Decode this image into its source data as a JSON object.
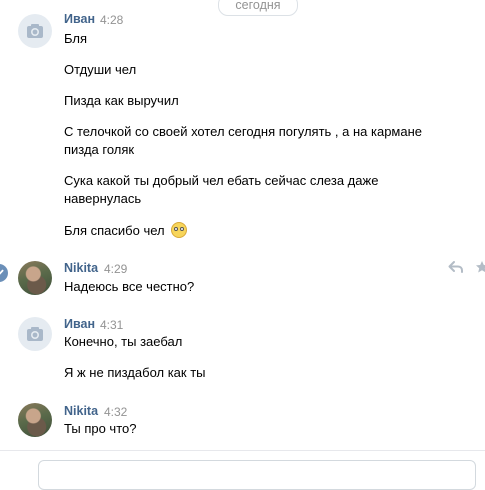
{
  "date_separator": "сегодня",
  "messages": [
    {
      "author": "Иван",
      "time": "4:28",
      "avatar": "camera-placeholder-icon",
      "lines": [
        [
          "Бля"
        ],
        [
          "Отдуши чел"
        ],
        [
          "Пизда как выручил"
        ],
        [
          "С телочкой со своей хотел сегодня погулять , а на кармане",
          "пизда голяк"
        ],
        [
          "Сука какой ты добрый чел ебать сейчас слеза даже",
          "навернулась"
        ],
        [
          "Бля спасибо чел"
        ]
      ]
    },
    {
      "author": "Nikita",
      "time": "4:29",
      "avatar": "user-photo",
      "lines": [
        [
          "Надеюсь все честно?"
        ]
      ]
    },
    {
      "author": "Иван",
      "time": "4:31",
      "avatar": "camera-placeholder-icon",
      "lines": [
        [
          "Конечно, ты заебал"
        ],
        [
          "Я ж не пиздабол как ты"
        ]
      ]
    },
    {
      "author": "Nikita",
      "time": "4:32",
      "avatar": "user-photo",
      "lines": [
        [
          "Ты про что?"
        ]
      ]
    }
  ],
  "icons": {
    "emoji": "tearful-smile-emoji-icon",
    "reply": "reply-icon",
    "favorite": "star-icon",
    "selected": "check-icon"
  },
  "colors": {
    "author": "#42648b",
    "time": "#939393",
    "avatar_placeholder": "#e5ebf1",
    "selected_check": "#6b8fb8"
  }
}
